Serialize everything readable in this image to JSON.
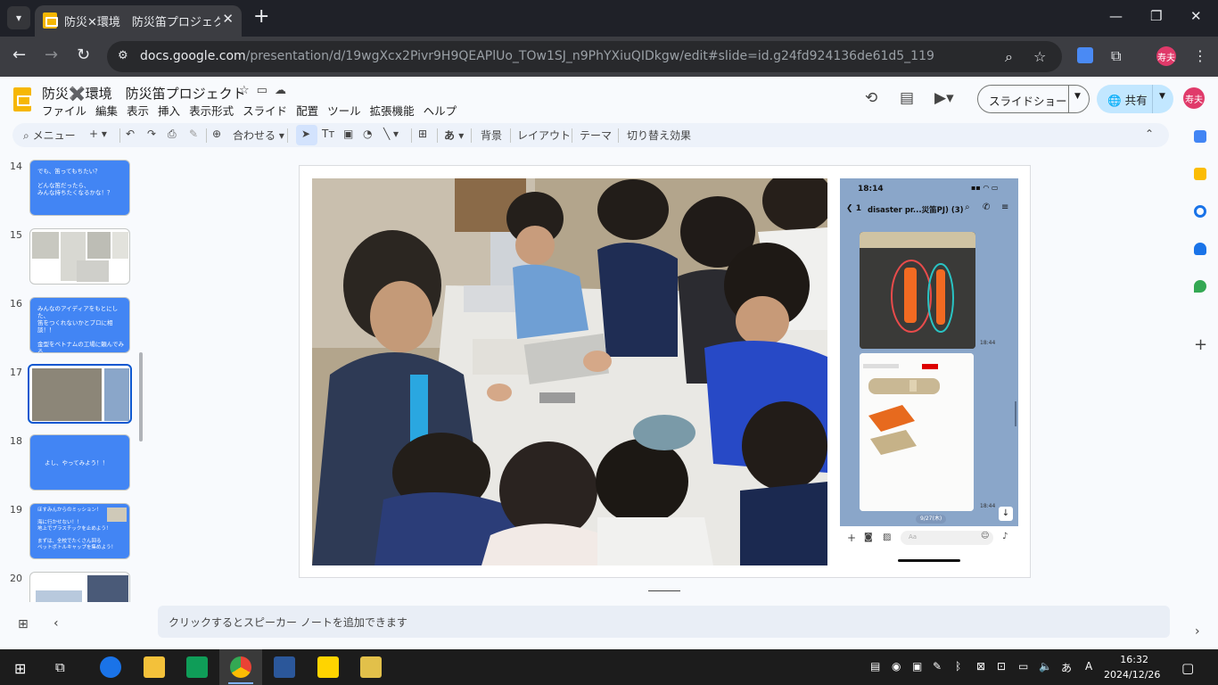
{
  "browser": {
    "tab_title": "防災✕環境　防災笛プロジェクト",
    "url_domain": "docs.google.com",
    "url_path": "/presentation/d/19wgXcx2Pivr9H9QEAPlUo_TOw1SJ_n9PhYXiuQIDkgw/edit#slide=id.g24fd924136de61d5_119",
    "profile_initials": "寿夫"
  },
  "doc": {
    "title": "防災✖️環境　防災笛プロジェクト",
    "menu": [
      "ファイル",
      "編集",
      "表示",
      "挿入",
      "表示形式",
      "スライド",
      "配置",
      "ツール",
      "拡張機能",
      "ヘルプ"
    ],
    "slideshow_label": "スライドショー",
    "share_label": "共有",
    "user_initials": "寿夫"
  },
  "toolbar": {
    "menu_search": "メニュー",
    "zoom": "合わせる",
    "font_btn": "あ",
    "background": "背景",
    "layout": "レイアウト",
    "theme": "テーマ",
    "transition": "切り替え効果"
  },
  "filmstrip": {
    "slides": [
      {
        "num": "14",
        "text": "でも、笛ってもちたい？\n\nどんな笛だったら、\nみんな持ちたくなるかな！？"
      },
      {
        "num": "15",
        "text": ""
      },
      {
        "num": "16",
        "text": "みんなのアイディアをもとにした、\n笛をつくれないかとプロに相談！！\n\n金型をベトナムの工場に頼んでみる\nという方法がある。"
      },
      {
        "num": "17",
        "text": ""
      },
      {
        "num": "18",
        "text": "よし、やってみよう！！"
      },
      {
        "num": "19",
        "text": "ほすみんからのミッション！\n\n海に行かせない！！\n地上でプラスチックを止めよう！\n\nまずは、全校でたくさん回る\nペットボトルキャップを集めよう！"
      },
      {
        "num": "20",
        "text": ""
      }
    ]
  },
  "phone": {
    "time": "18:14",
    "chat_title": "disaster pr...災笛PJ) (3)",
    "back_count": "1",
    "msg_time1": "18:44",
    "msg_time2": "18:44",
    "date_chip": "9/27(木)",
    "input_placeholder": "Aa"
  },
  "notes": {
    "placeholder": "クリックするとスピーカー ノートを追加できます"
  },
  "taskbar": {
    "time": "16:32",
    "date": "2024/12/26"
  }
}
